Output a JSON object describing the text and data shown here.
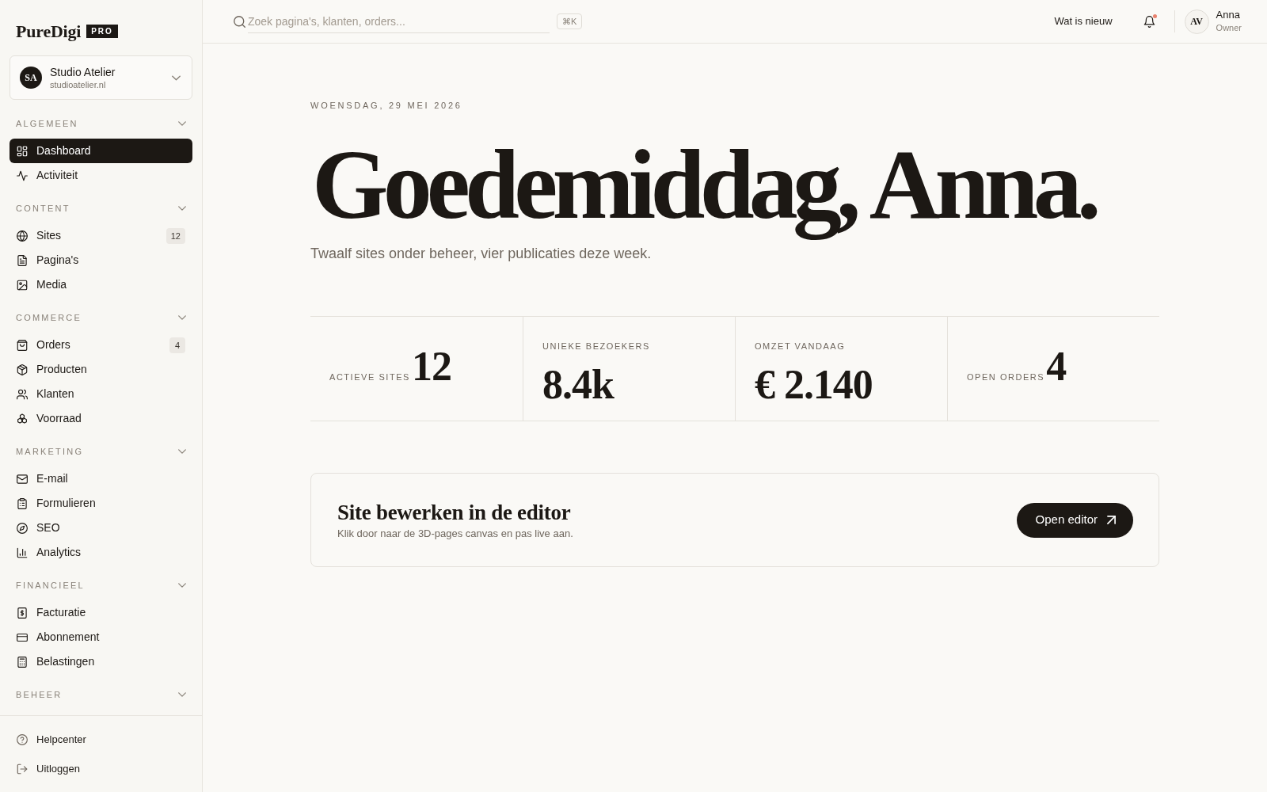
{
  "sidebar": {
    "logo": {
      "wordmark": "PureDigi",
      "badge": "PRO"
    },
    "workspace": {
      "initials": "SA",
      "name": "Studio Atelier",
      "domain": "studioatelier.nl"
    },
    "sections": [
      {
        "title": "ALGEMEEN",
        "items": [
          {
            "label": "Dashboard",
            "selected": true
          },
          {
            "label": "Activiteit",
            "selected": false
          }
        ]
      },
      {
        "title": "CONTENT",
        "items": [
          {
            "label": "Sites",
            "badge": "12",
            "selected": false
          },
          {
            "label": "Pagina's",
            "selected": false
          },
          {
            "label": "Media",
            "selected": false
          }
        ]
      },
      {
        "title": "COMMERCE",
        "items": [
          {
            "label": "Orders",
            "badge": "4",
            "selected": false
          },
          {
            "label": "Producten",
            "selected": false
          },
          {
            "label": "Klanten",
            "selected": false
          },
          {
            "label": "Voorraad",
            "selected": false
          }
        ]
      },
      {
        "title": "MARKETING",
        "items": [
          {
            "label": "E-mail",
            "selected": false
          },
          {
            "label": "Formulieren",
            "selected": false
          },
          {
            "label": "SEO",
            "selected": false
          },
          {
            "label": "Analytics",
            "selected": false
          }
        ]
      },
      {
        "title": "FINANCIEEL",
        "items": [
          {
            "label": "Facturatie",
            "selected": false
          },
          {
            "label": "Abonnement",
            "selected": false
          },
          {
            "label": "Belastingen",
            "selected": false
          }
        ]
      },
      {
        "title": "BEHEER"
      }
    ],
    "footer_items": [
      {
        "label": "Helpcenter"
      },
      {
        "label": "Uitloggen"
      }
    ]
  },
  "topbar": {
    "search": {
      "placeholder": "Zoek pagina's, klanten, orders...",
      "shortcut": "⌘K"
    },
    "whats_new": "Wat is nieuw",
    "notifications": {
      "unread": true
    },
    "user": {
      "initials": "AV",
      "name": "Anna",
      "role": "Owner"
    }
  },
  "main": {
    "date": "WOENSDAG, 29 MEI 2026",
    "greeting": "Goedemiddag, Anna.",
    "summary": "Twaalf sites onder beheer, vier publicaties deze week.",
    "stats": [
      {
        "kind": "inline",
        "label": "ACTIEVE SITES",
        "value": "12"
      },
      {
        "kind": "stacked",
        "label": "UNIEKE BEZOEKERS",
        "value": "8.4k"
      },
      {
        "kind": "stacked",
        "label": "OMZET VANDAAG",
        "value": "€ 2.140"
      },
      {
        "kind": "inline",
        "label": "OPEN ORDERS",
        "value": "4"
      }
    ],
    "editor_card": {
      "title": "Site bewerken in de editor",
      "description": "Klik door naar de 3D-pages canvas en pas live aan.",
      "button": "Open editor"
    }
  }
}
